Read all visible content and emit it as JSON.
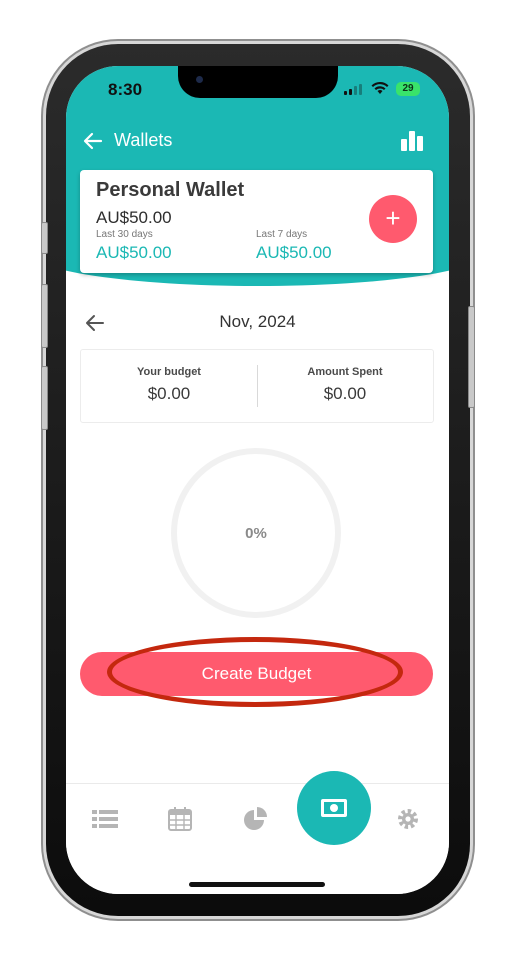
{
  "status_bar": {
    "time": "8:30",
    "battery": "29"
  },
  "header": {
    "title": "Wallets",
    "back_icon": "arrow-left-icon",
    "stats_icon": "bar-chart-icon"
  },
  "wallet": {
    "name": "Personal Wallet",
    "balance": "AU$50.00",
    "last30_label": "Last 30 days",
    "last30_amount": "AU$50.00",
    "last7_label": "Last 7 days",
    "last7_amount": "AU$50.00",
    "add_label": "+"
  },
  "month": {
    "label": "Nov, 2024"
  },
  "budget": {
    "your_budget_label": "Your budget",
    "your_budget_value": "$0.00",
    "spent_label": "Amount Spent",
    "spent_value": "$0.00",
    "percent": "0%"
  },
  "actions": {
    "create_budget": "Create Budget"
  },
  "tabs": [
    {
      "icon": "list-icon"
    },
    {
      "icon": "calendar-icon"
    },
    {
      "icon": "pie-chart-icon"
    },
    {
      "icon": "money-icon",
      "active": true
    },
    {
      "icon": "gear-icon"
    }
  ],
  "colors": {
    "teal": "#1bb8b4",
    "pink": "#ff5a6e",
    "highlight": "#c4280e"
  }
}
